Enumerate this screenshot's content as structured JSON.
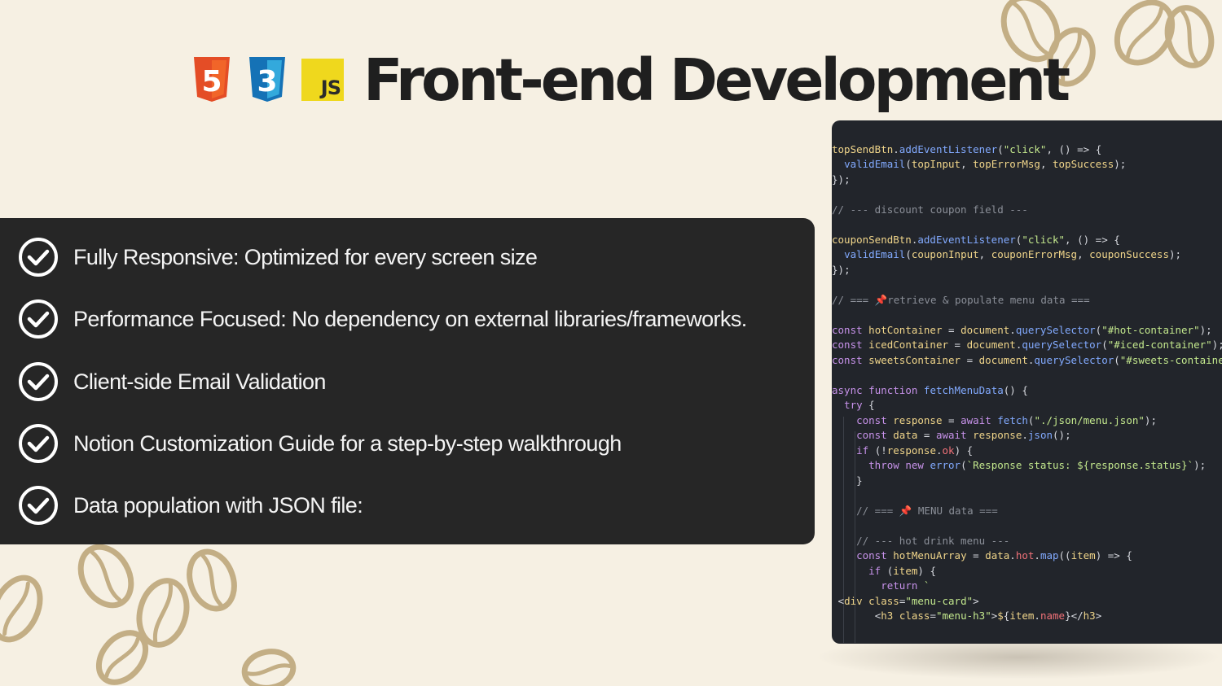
{
  "header": {
    "title": "Front-end Development",
    "logos": [
      {
        "name": "html5-logo",
        "label": "5",
        "color": "#e44d26"
      },
      {
        "name": "css3-logo",
        "label": "3",
        "color": "#2965f1"
      },
      {
        "name": "js-logo",
        "label": "JS",
        "color": "#efd81d"
      }
    ]
  },
  "features": [
    {
      "text": "Fully Responsive: Optimized for every screen size",
      "icon": "check-circle-icon"
    },
    {
      "text": "Performance Focused: No dependency on external libraries/frameworks.",
      "icon": "check-circle-icon"
    },
    {
      "text": "Client-side Email Validation",
      "icon": "check-circle-icon"
    },
    {
      "text": "Notion Customization Guide for a step-by-step walkthrough",
      "icon": "check-circle-icon"
    },
    {
      "text": "Data population with JSON file:",
      "icon": "check-circle-icon"
    }
  ],
  "code": {
    "lines": [
      "",
      "topSendBtn.addEventListener(\"click\", () => {",
      "  validEmail(topInput, topErrorMsg, topSuccess);",
      "});",
      "",
      "// --- discount coupon field ---",
      "",
      "couponSendBtn.addEventListener(\"click\", () => {",
      "  validEmail(couponInput, couponErrorMsg, couponSuccess);",
      "});",
      "",
      "// === 📌retrieve & populate menu data ===",
      "",
      "const hotContainer = document.querySelector(\"#hot-container\");",
      "const icedContainer = document.querySelector(\"#iced-container\");",
      "const sweetsContainer = document.querySelector(\"#sweets-container\");",
      "",
      "async function fetchMenuData() {",
      "  try {",
      "    const response = await fetch(\"./json/menu.json\");",
      "    const data = await response.json();",
      "    if (!response.ok) {",
      "      throw new error(`Response status: ${response.status}`);",
      "    }",
      "",
      "    // === 📌 MENU data ===",
      "",
      "    // --- hot drink menu ---",
      "    const hotMenuArray = data.hot.map((item) => {",
      "      if (item) {",
      "        return `",
      " <div class=\"menu-card\">",
      "       <h3 class=\"menu-h3\">${item.name}</h3>"
    ]
  },
  "colors": {
    "background": "#f6f0e3",
    "panel": "#262626",
    "code_bg": "#22252b",
    "beans": "#c3ae85"
  }
}
